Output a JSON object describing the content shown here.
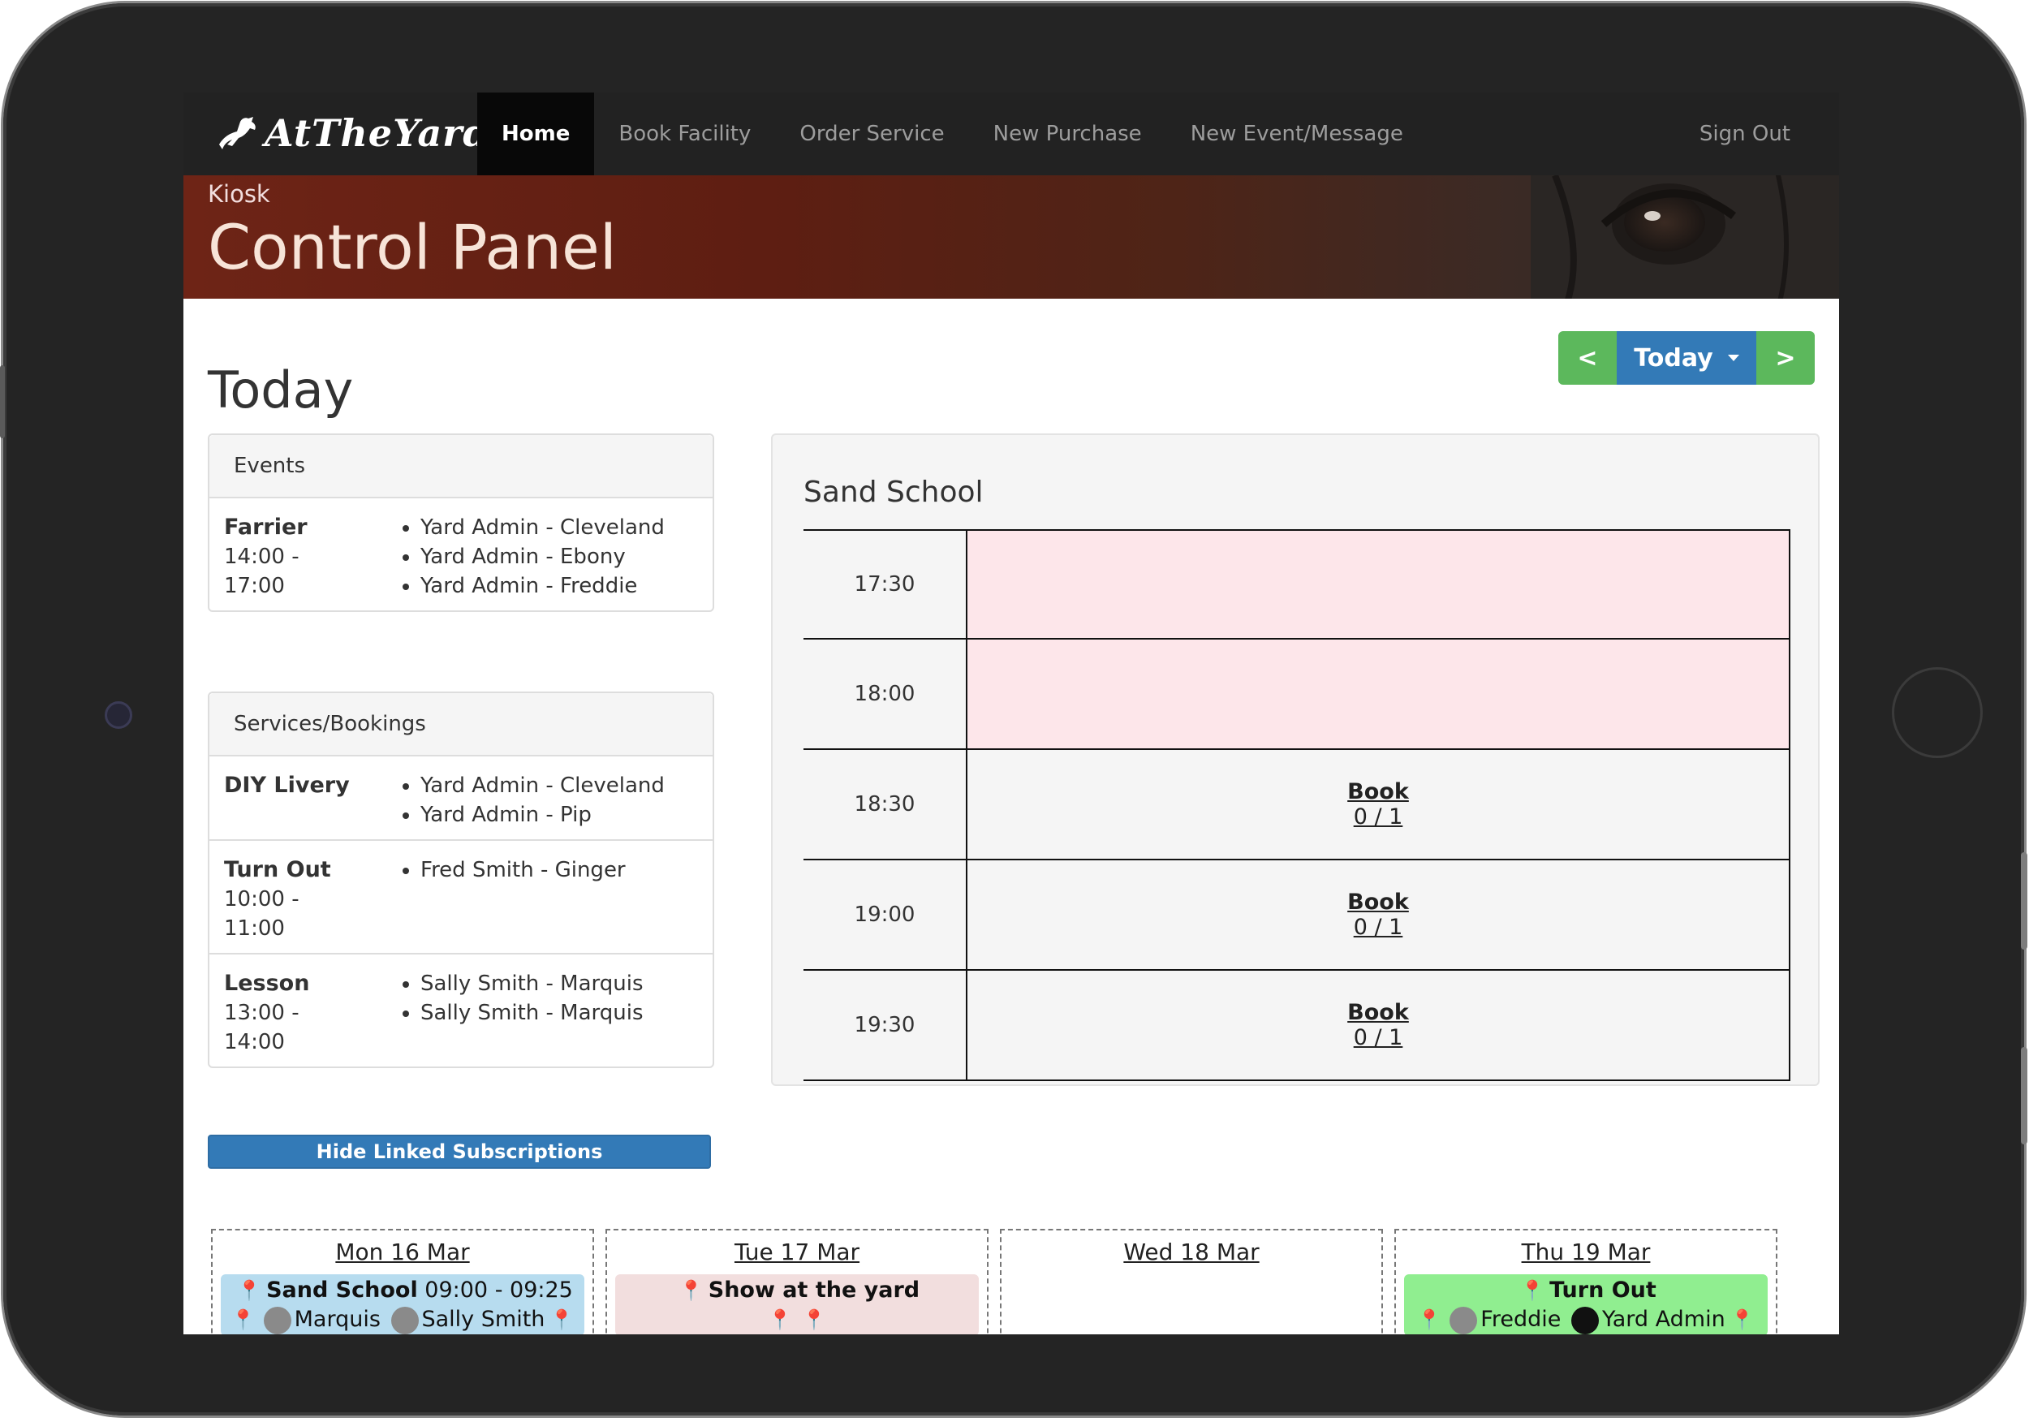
{
  "app": {
    "brand": "AtTheYard"
  },
  "nav": {
    "items": [
      "Home",
      "Book Facility",
      "Order Service",
      "New Purchase",
      "New Event/Message"
    ],
    "active": "Home",
    "sign_out": "Sign Out"
  },
  "header": {
    "kicker": "Kiosk",
    "title": "Control Panel"
  },
  "page": {
    "title": "Today"
  },
  "date_nav": {
    "prev": "<",
    "today": "Today",
    "next": ">"
  },
  "events_panel": {
    "heading": "Events",
    "rows": [
      {
        "name": "Farrier",
        "time_start": "14:00 -",
        "time_end": "17:00",
        "people": [
          "Yard Admin - Cleveland",
          "Yard Admin - Ebony",
          "Yard Admin - Freddie"
        ]
      }
    ]
  },
  "services_panel": {
    "heading": "Services/Bookings",
    "rows": [
      {
        "name": "DIY Livery",
        "time_start": "",
        "time_end": "",
        "people": [
          "Yard Admin - Cleveland",
          "Yard Admin - Pip"
        ]
      },
      {
        "name": "Turn Out",
        "time_start": "10:00 -",
        "time_end": "11:00",
        "people": [
          "Fred Smith - Ginger"
        ]
      },
      {
        "name": "Lesson",
        "time_start": "13:00 -",
        "time_end": "14:00",
        "people": [
          "Sally Smith - Marquis",
          "Sally Smith - Marquis"
        ]
      }
    ]
  },
  "hide_linked_button": "Hide Linked Subscriptions",
  "facility": {
    "title": "Sand School",
    "slots": [
      {
        "time": "17:30",
        "booked": true,
        "label": "",
        "count": ""
      },
      {
        "time": "18:00",
        "booked": true,
        "label": "",
        "count": ""
      },
      {
        "time": "18:30",
        "booked": false,
        "label": "Book",
        "count": "0 / 1"
      },
      {
        "time": "19:00",
        "booked": false,
        "label": "Book",
        "count": "0 / 1"
      },
      {
        "time": "19:30",
        "booked": false,
        "label": "Book",
        "count": "0 / 1"
      }
    ]
  },
  "calendar": {
    "days": [
      {
        "label": "Mon 16 Mar",
        "event": {
          "title": "Sand School",
          "time": "09:00 - 09:25",
          "horse": "Marquis",
          "person": "Sally Smith",
          "color": "#b7dcef"
        }
      },
      {
        "label": "Tue 17 Mar",
        "event": {
          "title": "Show at the yard",
          "color": "#f2dede"
        }
      },
      {
        "label": "Wed 18 Mar"
      },
      {
        "label": "Thu 19 Mar",
        "event": {
          "title": "Turn Out",
          "horse": "Freddie",
          "person": "Yard Admin",
          "color": "#90ee90"
        }
      }
    ]
  },
  "colors": {
    "navbar": "#222222",
    "primary": "#337ab7",
    "success": "#5cb85c",
    "booked_slot": "#fde6ea"
  }
}
